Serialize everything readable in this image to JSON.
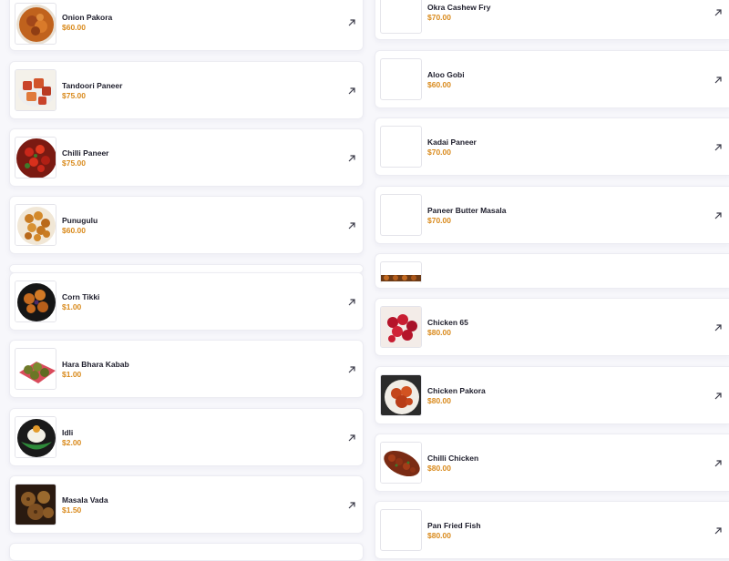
{
  "left_column": [
    {
      "name": "Onion Pakora",
      "price": "$60.00",
      "icon": "onion-pakora-image"
    },
    {
      "name": "Tandoori Paneer",
      "price": "$75.00",
      "icon": "tandoori-paneer-image"
    },
    {
      "name": "Chilli Paneer",
      "price": "$75.00",
      "icon": "chilli-paneer-image"
    },
    {
      "name": "Punugulu",
      "price": "$60.00",
      "icon": "punugulu-image"
    },
    {
      "name": "Corn Tikki",
      "price": "$1.00",
      "icon": "corn-tikki-image"
    },
    {
      "name": "Hara Bhara Kabab",
      "price": "$1.00",
      "icon": "hara-bhara-kabab-image"
    },
    {
      "name": "Idli",
      "price": "$2.00",
      "icon": "idli-image"
    },
    {
      "name": "Masala Vada",
      "price": "$1.50",
      "icon": "masala-vada-image"
    }
  ],
  "right_column": [
    {
      "name": "Okra Cashew Fry",
      "price": "$70.00",
      "icon": "empty-image"
    },
    {
      "name": "Aloo Gobi",
      "price": "$60.00",
      "icon": "empty-image"
    },
    {
      "name": "Kadai Paneer",
      "price": "$70.00",
      "icon": "empty-image"
    },
    {
      "name": "Paneer Butter Masala",
      "price": "$70.00",
      "icon": "empty-image"
    },
    {
      "name": "",
      "price": "",
      "icon": "partial-image"
    },
    {
      "name": "Chicken 65",
      "price": "$80.00",
      "icon": "chicken-65-image"
    },
    {
      "name": "Chicken Pakora",
      "price": "$80.00",
      "icon": "chicken-pakora-image"
    },
    {
      "name": "Chilli Chicken",
      "price": "$80.00",
      "icon": "chilli-chicken-image"
    },
    {
      "name": "Pan Fried Fish",
      "price": "$80.00",
      "icon": "empty-image"
    }
  ],
  "colors": {
    "price": "#d98a1c",
    "name": "#1d1d2b",
    "background": "#f7f7fb"
  },
  "open_icon": "arrow-up-right-icon"
}
